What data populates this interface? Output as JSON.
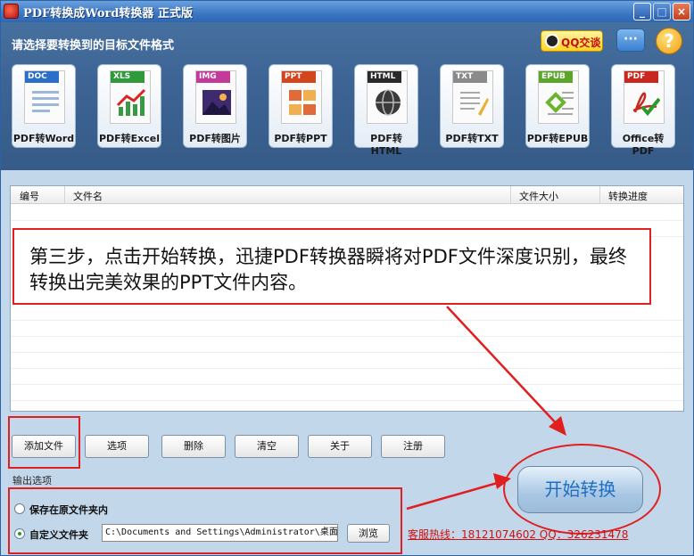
{
  "window": {
    "title": "PDF转换成Word转换器 正式版",
    "minimize_glyph": "_",
    "maximize_glyph": "□",
    "close_glyph": "×"
  },
  "header": {
    "label": "请选择要转换到的目标文件格式",
    "qq_badge": "QQ交谈",
    "chat_glyph": "···",
    "help_glyph": "?"
  },
  "formats": [
    {
      "tag": "DOC",
      "label": "PDF转Word",
      "color": "#2b6fc9"
    },
    {
      "tag": "XLS",
      "label": "PDF转Excel",
      "color": "#2f9a3a"
    },
    {
      "tag": "IMG",
      "label": "PDF转图片",
      "color": "#c23b9a"
    },
    {
      "tag": "PPT",
      "label": "PDF转PPT",
      "color": "#d2461e"
    },
    {
      "tag": "HTML",
      "label": "PDF转HTML",
      "color": "#2a2a2a"
    },
    {
      "tag": "TXT",
      "label": "PDF转TXT",
      "color": "#8a8a8a"
    },
    {
      "tag": "EPUB",
      "label": "PDF转EPUB",
      "color": "#5aa52a"
    },
    {
      "tag": "PDF",
      "label": "Office转PDF",
      "color": "#c8281e"
    }
  ],
  "file_list": {
    "columns": [
      "编号",
      "文件名",
      "文件大小",
      "转换进度"
    ],
    "rows": []
  },
  "callout": {
    "text": "第三步，点击开始转换，迅捷PDF转换器瞬将对PDF文件深度识别，最终转换出完美效果的PPT文件内容。"
  },
  "buttons": {
    "add_file": "添加文件",
    "options": "选项",
    "delete": "删除",
    "clear": "清空",
    "about": "关于",
    "register": "注册",
    "browse": "浏览",
    "start": "开始转换"
  },
  "output": {
    "section_label": "输出选项",
    "option_original": "保存在原文件夹内",
    "option_custom": "自定义文件夹",
    "custom_selected": true,
    "path_value": "C:\\Documents and Settings\\Administrator\\桌面"
  },
  "hotline": "客服热线：18121074602 QQ：326231478",
  "colors": {
    "annotation_red": "#e02020",
    "title_bar": "#3b76c2",
    "header_band": "#3d6494",
    "window_bg": "#c3d7ea",
    "start_text": "#1f6fc0"
  }
}
